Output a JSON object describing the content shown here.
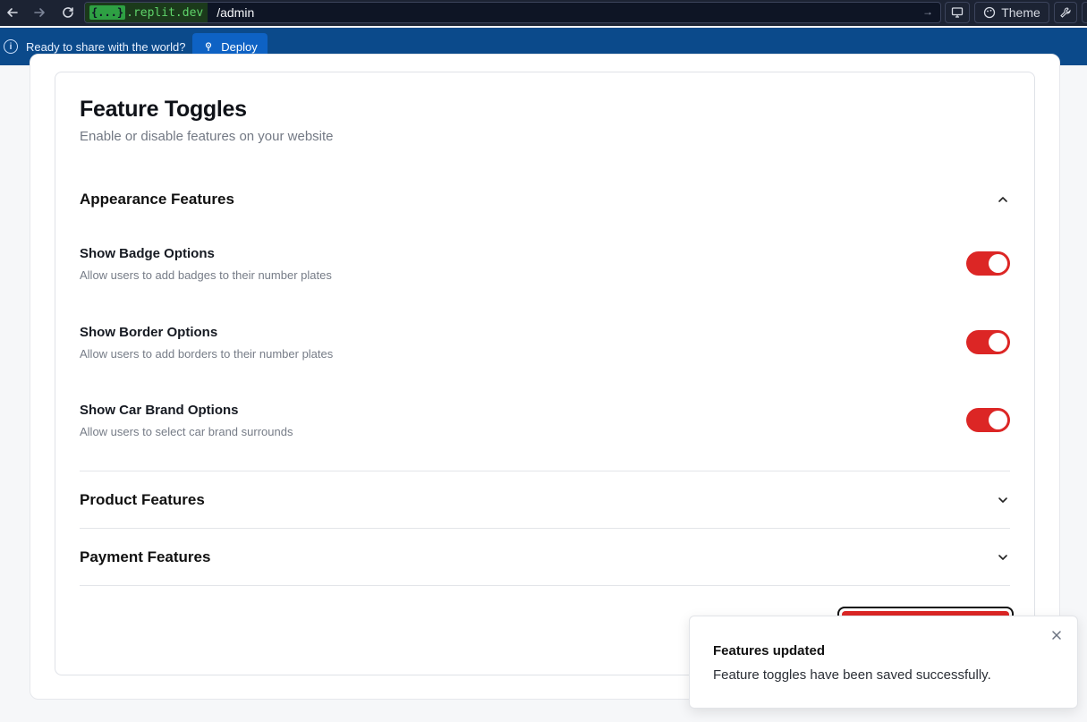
{
  "browser": {
    "url_domain_brace": "{...}",
    "url_domain_rest": ".replit.dev",
    "url_path": "/admin",
    "theme_label": "Theme"
  },
  "banner": {
    "text": "Ready to share with the world?",
    "deploy_label": "Deploy"
  },
  "page": {
    "title": "Feature Toggles",
    "subtitle": "Enable or disable features on your website"
  },
  "sections": [
    {
      "title": "Appearance Features",
      "expanded": true,
      "features": [
        {
          "name": "Show Badge Options",
          "description": "Allow users to add badges to their number plates",
          "enabled": true
        },
        {
          "name": "Show Border Options",
          "description": "Allow users to add borders to their number plates",
          "enabled": true
        },
        {
          "name": "Show Car Brand Options",
          "description": "Allow users to select car brand surrounds",
          "enabled": true
        }
      ]
    },
    {
      "title": "Product Features",
      "expanded": false
    },
    {
      "title": "Payment Features",
      "expanded": false
    }
  ],
  "toast": {
    "title": "Features updated",
    "description": "Feature toggles have been saved successfully."
  },
  "colors": {
    "accent": "#dc2625",
    "banner": "#0b4a8b",
    "toolbar": "#1c2333"
  }
}
